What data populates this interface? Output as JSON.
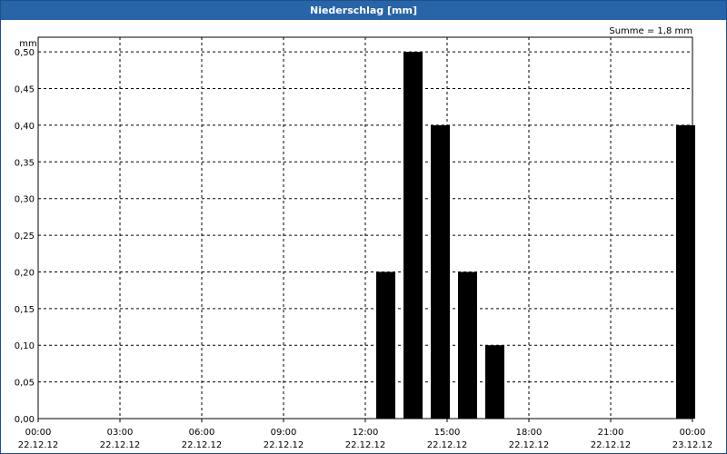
{
  "window": {
    "title": "Niederschlag [mm]"
  },
  "chart_data": {
    "type": "bar",
    "title": "Niederschlag [mm]",
    "annotation": "Summe = 1,8 mm",
    "ylabel": "mm",
    "xlabel": "",
    "ylim": [
      0,
      0.52
    ],
    "y_ticks": [
      "0,00",
      "0,05",
      "0,10",
      "0,15",
      "0,20",
      "0,25",
      "0,30",
      "0,35",
      "0,40",
      "0,45",
      "0,50"
    ],
    "y_tick_values": [
      0,
      0.05,
      0.1,
      0.15,
      0.2,
      0.25,
      0.3,
      0.35,
      0.4,
      0.45,
      0.5
    ],
    "x_range_hours": [
      0,
      24
    ],
    "x_ticks": [
      {
        "time": "00:00",
        "date": "22.12.12",
        "hour": 0
      },
      {
        "time": "03:00",
        "date": "22.12.12",
        "hour": 3
      },
      {
        "time": "06:00",
        "date": "22.12.12",
        "hour": 6
      },
      {
        "time": "09:00",
        "date": "22.12.12",
        "hour": 9
      },
      {
        "time": "12:00",
        "date": "22.12.12",
        "hour": 12
      },
      {
        "time": "15:00",
        "date": "22.12.12",
        "hour": 15
      },
      {
        "time": "18:00",
        "date": "22.12.12",
        "hour": 18
      },
      {
        "time": "21:00",
        "date": "22.12.12",
        "hour": 21
      },
      {
        "time": "00:00",
        "date": "23.12.12",
        "hour": 24
      }
    ],
    "bars": [
      {
        "hour": 12.4,
        "value": 0.2
      },
      {
        "hour": 13.4,
        "value": 0.5
      },
      {
        "hour": 14.4,
        "value": 0.4
      },
      {
        "hour": 15.4,
        "value": 0.2
      },
      {
        "hour": 16.4,
        "value": 0.1
      },
      {
        "hour": 23.4,
        "value": 0.4
      }
    ],
    "bar_color": "#000000",
    "grid": true
  }
}
